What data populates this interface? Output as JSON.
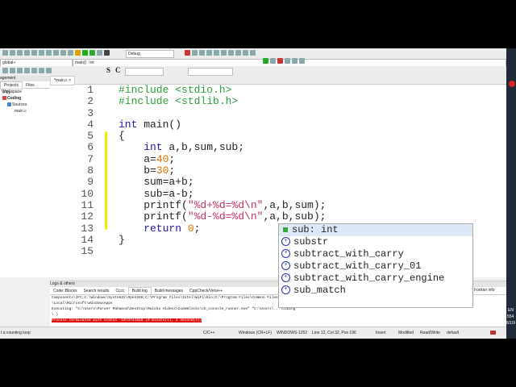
{
  "toolbar": {
    "build_target": "Debug",
    "scope": "global»",
    "function": "main() : int",
    "s_btn": "S",
    "c_btn": "C"
  },
  "management": {
    "title": "agement",
    "tabs": [
      "Projects",
      "Files",
      "FSy"
    ],
    "tree": [
      "Workspace",
      "Coding",
      "Sources",
      "main.c"
    ]
  },
  "editor": {
    "tab": "*main.c",
    "line_numbers": [
      "1",
      "2",
      "3",
      "4",
      "5",
      "6",
      "7",
      "8",
      "9",
      "10",
      "11",
      "12",
      "13",
      "14",
      "15"
    ]
  },
  "code": {
    "l1": "#include <stdio.h>",
    "l2": "#include <stdlib.h>",
    "l4a": "int",
    "l4b": " main()",
    "l5": "{",
    "l6a": "    int",
    "l6b": " a,b,sum,sub;",
    "l7a": "    a=",
    "l7b": "40",
    "l7c": ";",
    "l8a": "    b=",
    "l8b": "30",
    "l8c": ";",
    "l9": "    sum=a+b;",
    "l10": "    sub=a-b;",
    "l11a": "    printf(",
    "l11b": "\"%d+%d=%d\\n\"",
    "l11c": ",a,b,sum);",
    "l12a": "    printf(",
    "l12b": "\"%d-%d=%d\\n\"",
    "l12c": ",a,b,sub);",
    "l13a": "    return",
    "l13b": " 0",
    "l13c": ";",
    "l14": "}"
  },
  "autocomplete": {
    "items": [
      "sub: int",
      "substr",
      "subtract_with_carry",
      "subtract_with_carry_01",
      "subtract_with_carry_engine",
      "sub_match"
    ]
  },
  "logs": {
    "title": "Logs & others",
    "tabs": [
      "Code::Blocks",
      "Search results",
      "Cccc",
      "Build log",
      "Build messages",
      "CppCheck/Vera++",
      "Fortran info"
    ],
    "lines": [
      "Components\\IFC;C:\\Windows\\System32\\OpenSSH;C:\\Program Files\\Intel\\WiFi\\bin;C:\\Program Files\\Common Files ...\\AppData",
      "\\Local\\Microsoft\\WindowsApps",
      "Executing: \"C:\\Users\\Parver Mahmood\\Desktop\\Maisha Videos\\CodeBlocks\\cb_console_runner.exe\" \"C:\\Users\\...\\Coding",
      "\\.)"
    ],
    "error": "Process terminated with status -1073741510 (0 minute(s), 2 second(s))"
  },
  "status": {
    "hint": "t a counting loop",
    "lang": "C/C++",
    "eol": "Windows (CR+LF)",
    "enc": "WINDOWS-1252",
    "pos": "Line 12, Col 32, Pos 196",
    "mode": "Insert",
    "mod": "Modified",
    "rw": "Read/Write",
    "profile": "default"
  },
  "tray": {
    "lang": "EN",
    "time": "554",
    "date": "6/10/"
  }
}
